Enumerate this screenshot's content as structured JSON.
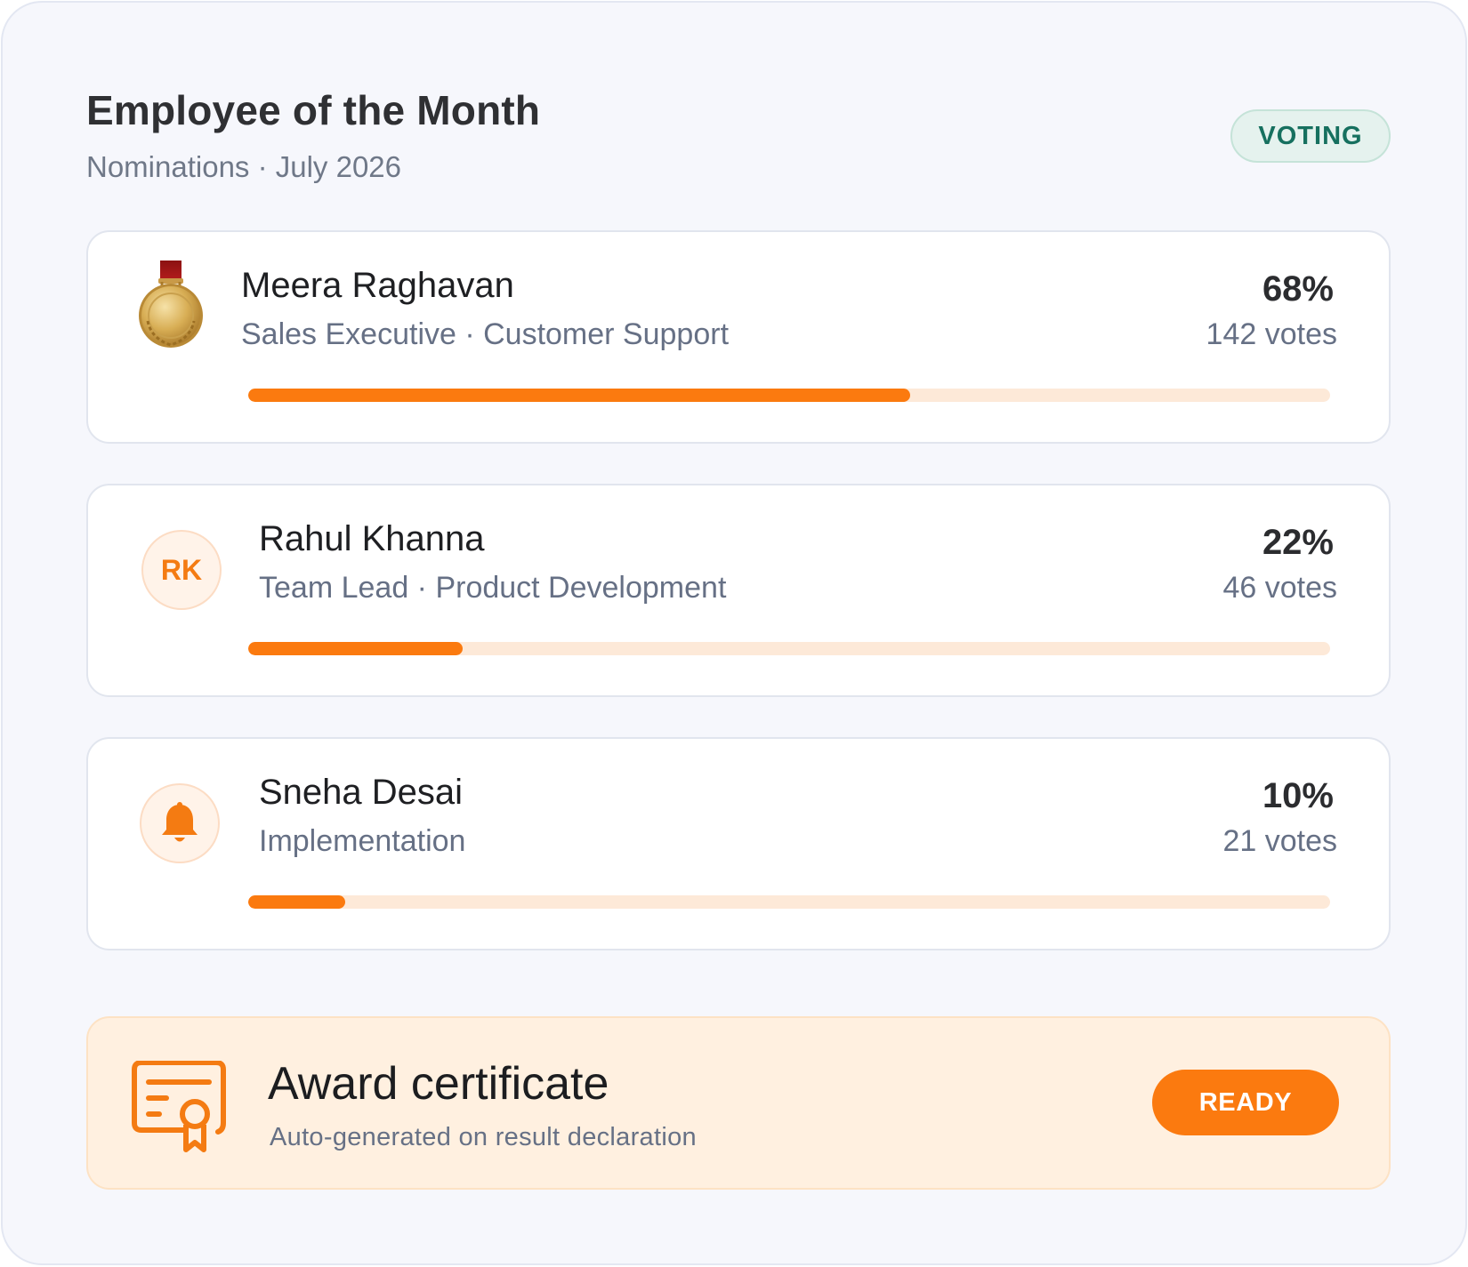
{
  "header": {
    "title": "Employee of the Month",
    "subtitle": "Nominations · July 2026",
    "status_badge": "VOTING"
  },
  "nominees": [
    {
      "name": "Meera Raghavan",
      "meta": "Sales Executive · Customer Support",
      "percent_label": "68%",
      "votes_label": "142 votes",
      "share": 0.68,
      "icon": "gold-medal-icon"
    },
    {
      "name": "Rahul Khanna",
      "meta": "Team Lead · Product Development",
      "percent_label": "22%",
      "votes_label": "46 votes",
      "share": 0.22,
      "initials": "RK"
    },
    {
      "name": "Sneha Desai",
      "meta": "Implementation",
      "percent_label": "10%",
      "votes_label": "21 votes",
      "share": 0.1,
      "icon": "bell-icon"
    }
  ],
  "award": {
    "title": "Award certificate",
    "subtitle": "Auto-generated on result declaration",
    "status_label": "READY",
    "icon": "certificate-icon"
  },
  "colors": {
    "accent": "#fb7a0f",
    "track": "#fde9d8",
    "voting_badge_text": "#16705f",
    "voting_badge_bg": "#e5f2ee"
  }
}
